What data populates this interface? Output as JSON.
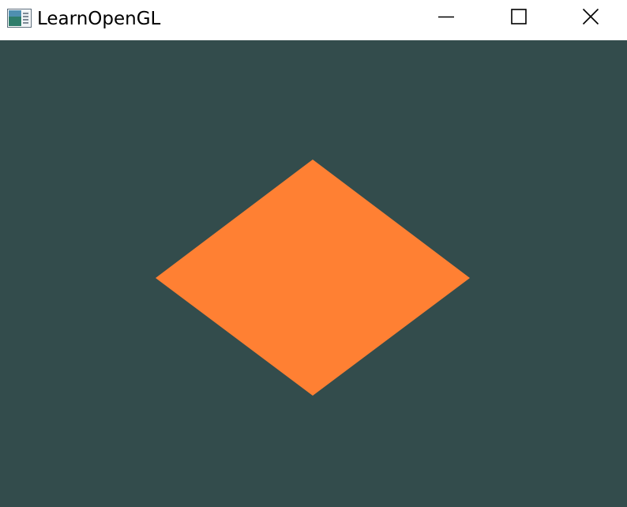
{
  "window": {
    "title": "LearnOpenGL",
    "controls": {
      "minimize": "minimize-icon",
      "maximize": "maximize-icon",
      "close": "close-icon"
    }
  },
  "scene": {
    "clear_color": "#334c4c",
    "shape": "diamond",
    "shape_color": "#ff8033"
  },
  "colors": {
    "titlebar_bg": "#ffffff",
    "title_text": "#000000",
    "control_glyph": "#000000"
  }
}
